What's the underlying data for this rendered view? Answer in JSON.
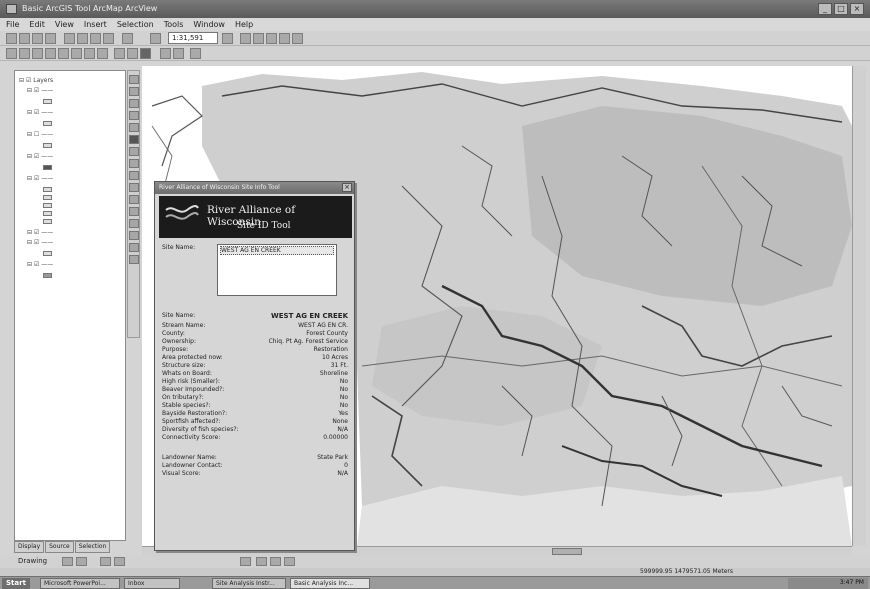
{
  "window": {
    "title": "Basic ArcGIS Tool  ArcMap  ArcView"
  },
  "menubar": [
    "File",
    "Edit",
    "View",
    "Insert",
    "Selection",
    "Tools",
    "Window",
    "Help"
  ],
  "toolbar": {
    "scale": "1:31,591"
  },
  "toc": {
    "tabs": [
      "Display",
      "Source",
      "Selection"
    ]
  },
  "dialog": {
    "title": "River Alliance of Wisconsin Site Info Tool",
    "banner_line1": "River Alliance of Wisconsin",
    "banner_line2": "Site ID Tool",
    "site_name_label": "Site Name:",
    "site_selected": "WEST AG EN CREEK",
    "attributes": [
      {
        "label": "Site Name:",
        "value": "WEST AG EN CREEK"
      },
      {
        "label": "Stream Name:",
        "value": "WEST AG EN CR."
      },
      {
        "label": "County:",
        "value": "Forest County"
      },
      {
        "label": "Ownership:",
        "value": "Chiq. Pt Ag.   Forest Service"
      },
      {
        "label": "Purpose:",
        "value": "Restoration"
      },
      {
        "label": "Area protected now:",
        "value": "10 Acres"
      },
      {
        "label": "Structure size:",
        "value": "31 Ft."
      },
      {
        "label": "Whats on Board:",
        "value": "Shoreline"
      },
      {
        "label": "High risk (Smaller):",
        "value": "No"
      },
      {
        "label": "Beaver Impounded?:",
        "value": "No"
      },
      {
        "label": "On tributary?:",
        "value": "No"
      },
      {
        "label": "Stable species?:",
        "value": "No"
      },
      {
        "label": "Bayside Restoration?:",
        "value": "Yes"
      },
      {
        "label": "Sportfish affected?:",
        "value": "None"
      },
      {
        "label": "Diversity of fish species?:",
        "value": "N/A"
      },
      {
        "label": "Connectivity Score:",
        "value": "0.00000"
      },
      {
        "label": "Landowner Name:",
        "value": "State Park"
      },
      {
        "label": "Landowner Contact:",
        "value": "0"
      },
      {
        "label": "Visual Score:",
        "value": "N/A"
      }
    ]
  },
  "drawbar": {
    "label": "Drawing"
  },
  "statusbar": {
    "coords": "599999.95  1479571.05 Meters"
  },
  "taskbar": {
    "start": "Start",
    "tasks": [
      "Microsoft PowerPoi...",
      "Inbox",
      "Site Analysis Instr...",
      "Basic Analysis Inc..."
    ],
    "clock": "3:47 PM"
  }
}
